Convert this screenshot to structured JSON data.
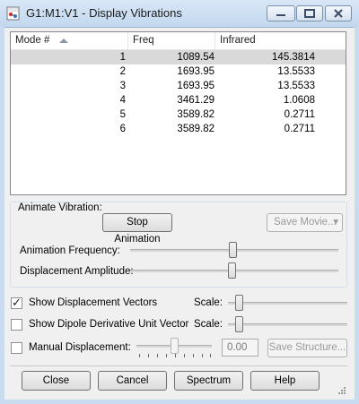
{
  "window": {
    "title": "G1:M1:V1 - Display Vibrations"
  },
  "table": {
    "columns": [
      "Mode #",
      "Freq",
      "Infrared"
    ],
    "rows": [
      {
        "mode": "1",
        "freq": "1089.54",
        "ir": "145.3814"
      },
      {
        "mode": "2",
        "freq": "1693.95",
        "ir": "13.5533"
      },
      {
        "mode": "3",
        "freq": "1693.95",
        "ir": "13.5533"
      },
      {
        "mode": "4",
        "freq": "3461.29",
        "ir": "1.0608"
      },
      {
        "mode": "5",
        "freq": "3589.82",
        "ir": "0.2711"
      },
      {
        "mode": "6",
        "freq": "3589.82",
        "ir": "0.2711"
      }
    ]
  },
  "animate": {
    "group_label": "Animate Vibration:",
    "stop_label": "Stop Animation",
    "save_movie_label": "Save Movie...",
    "frequency_label": "Animation Frequency:",
    "amplitude_label": "Displacement Amplitude:"
  },
  "options": {
    "show_vectors_label": "Show Displacement Vectors",
    "show_dipole_label": "Show Dipole Derivative Unit Vector",
    "manual_label": "Manual Displacement:",
    "scale_label": "Scale:",
    "manual_value": "0.00",
    "save_structure_label": "Save Structure..."
  },
  "buttons": {
    "close": "Close",
    "cancel": "Cancel",
    "spectrum": "Spectrum",
    "help": "Help"
  },
  "colors": {
    "titlebar": "#c9dbee",
    "close_button": "#c75050",
    "selected_row": "#d9d9d9"
  },
  "icons": [
    "app-icon",
    "minimize-icon",
    "maximize-icon",
    "close-icon",
    "sort-ascending-icon",
    "dropdown-arrow-icon",
    "checkmark-icon",
    "resize-grip-icon"
  ]
}
